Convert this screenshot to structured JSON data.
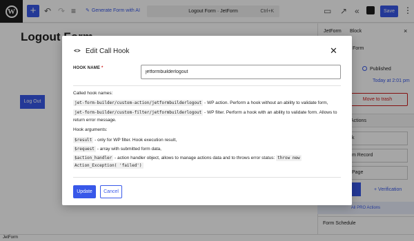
{
  "toolbar": {
    "wp_logo": "W",
    "add_icon": "+",
    "undo_icon": "↶",
    "redo_icon": "↷",
    "list_icon": "≡",
    "generate_ai_label": "Generate Form with AI",
    "command_title": "Logout Form · JetForm",
    "command_shortcut": "Ctrl+K",
    "save_label": "Save",
    "more_icon": "⋮"
  },
  "editor": {
    "page_title": "Logout Form",
    "logout_button_label": "Log Out"
  },
  "sidebar": {
    "tab_jetform": "JetForm",
    "tab_block": "Block",
    "close_icon": "×",
    "form_label": "Form",
    "status_label": "Published",
    "date_label": "Today at 2:01 pm",
    "trash_label": "Move to trash",
    "actions_label": "Actions",
    "action_items": [
      "k",
      "m Record",
      "Page"
    ],
    "verification_label": "+ Verification",
    "pro_actions_label": "All PRO Actions",
    "form_schedule_label": "Form Schedule"
  },
  "statusbar": {
    "label": "JetForm"
  },
  "modal": {
    "title": "Edit Call Hook",
    "hook_name_label": "HOOK NAME",
    "required_mark": "*",
    "hook_name_value": "jetformbuilderlogout",
    "called_hook_names_label": "Called hook names:",
    "hook_action_code": "jet-form-builder/custom-action/jetformbuilderlogout",
    "hook_action_desc": "- WP action. Perform a hook without an ability to validate form,",
    "hook_filter_code": "jet-form-builder/custom-filter/jetformbuilderlogout",
    "hook_filter_desc": "- WP filter. Perform a hook with an ability to validate form. Allows to",
    "hook_filter_desc2": "return error message.",
    "hook_arguments_label": "Hook arguments:",
    "arg_result_code": "$result",
    "arg_result_desc": "- only for WP filter. Hook execution result,",
    "arg_request_code": "$request",
    "arg_request_desc": "- array with submitted form data,",
    "arg_handler_code": "$action_handler",
    "arg_handler_desc": "- action handler object, allows to manage actions data and to throws error status:",
    "arg_throw_code": "throw new",
    "arg_exception_code": "Action_Exception( 'failed')",
    "update_label": "Update",
    "cancel_label": "Cancel"
  }
}
